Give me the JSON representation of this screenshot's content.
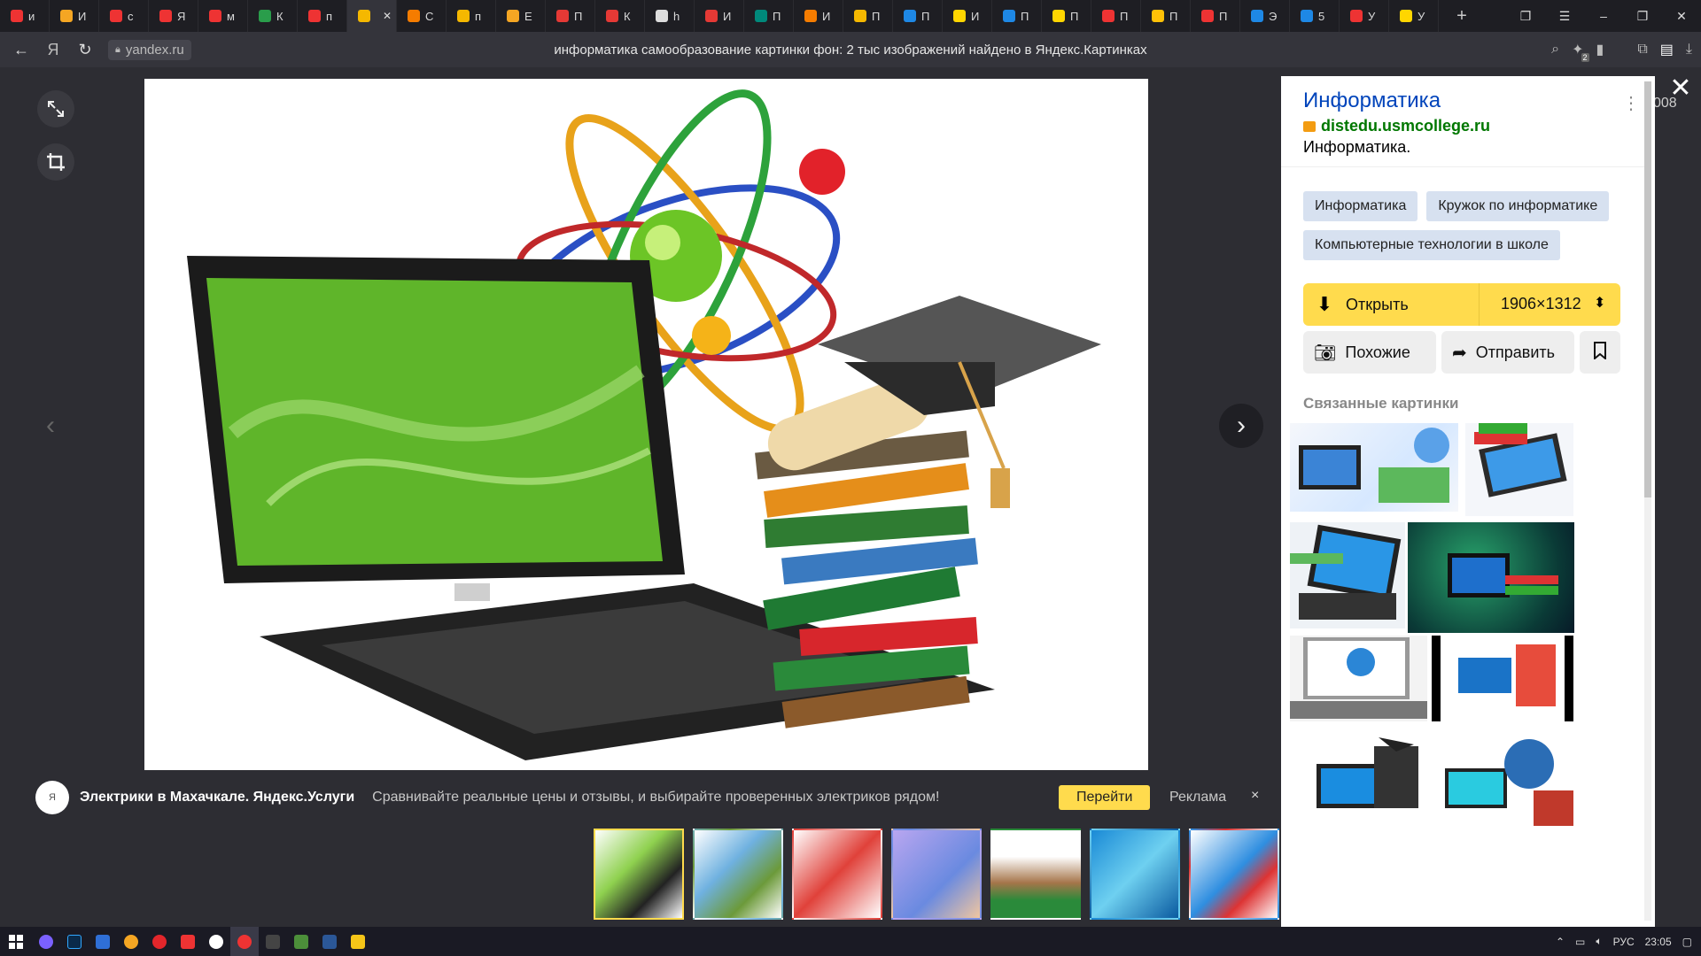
{
  "browser": {
    "tabs": [
      {
        "letter": "и",
        "icon": "yandex-icon",
        "color": "#e33"
      },
      {
        "letter": "И",
        "icon": "colorful-icon",
        "color": "#f5a623"
      },
      {
        "letter": "с",
        "icon": "yandex-icon",
        "color": "#e33"
      },
      {
        "letter": "Я",
        "icon": "yandex-icon",
        "color": "#e33"
      },
      {
        "letter": "м",
        "icon": "yandex-icon",
        "color": "#e33"
      },
      {
        "letter": "К",
        "icon": "green-doc-icon",
        "color": "#2a9d4b"
      },
      {
        "letter": "п",
        "icon": "yandex-icon",
        "color": "#e33"
      },
      {
        "letter": "",
        "icon": "images-icon",
        "color": "#f5b800"
      },
      {
        "letter": "С",
        "icon": "orange-m-icon",
        "color": "#f57c00"
      },
      {
        "letter": "п",
        "icon": "images-icon",
        "color": "#f5b800"
      },
      {
        "letter": "Е",
        "icon": "yellow-grid-icon",
        "color": "#f5a623"
      },
      {
        "letter": "П",
        "icon": "red-cup-icon",
        "color": "#e53935"
      },
      {
        "letter": "К",
        "icon": "youtube-icon",
        "color": "#e53935"
      },
      {
        "letter": "h",
        "icon": "page-icon",
        "color": "#ddd"
      },
      {
        "letter": "И",
        "icon": "youtube-icon",
        "color": "#e53935"
      },
      {
        "letter": "П",
        "icon": "teal-icon",
        "color": "#00897b"
      },
      {
        "letter": "И",
        "icon": "hat-icon",
        "color": "#f57c00"
      },
      {
        "letter": "П",
        "icon": "pencil-icon",
        "color": "#f5b800"
      },
      {
        "letter": "П",
        "icon": "blue-text-icon",
        "color": "#1e88e5"
      },
      {
        "letter": "И",
        "icon": "info-icon",
        "color": "#ffd600"
      },
      {
        "letter": "П",
        "icon": "book-icon",
        "color": "#1e88e5"
      },
      {
        "letter": "П",
        "icon": "info-icon",
        "color": "#ffd600"
      },
      {
        "letter": "П",
        "icon": "yandex-icon",
        "color": "#e33"
      },
      {
        "letter": "П",
        "icon": "play-icon",
        "color": "#ffc107"
      },
      {
        "letter": "П",
        "icon": "yandex-icon",
        "color": "#e33"
      },
      {
        "letter": "Э",
        "icon": "person-icon",
        "color": "#1e88e5"
      },
      {
        "letter": "5",
        "icon": "person-icon",
        "color": "#1e88e5"
      },
      {
        "letter": "У",
        "icon": "yandex-icon",
        "color": "#e33"
      },
      {
        "letter": "У",
        "icon": "info-icon",
        "color": "#ffd600"
      }
    ],
    "new_tab": "+",
    "url": "yandex.ru",
    "page_title": "информатика самообразование картинки фон: 2 тыс изображений найдено в Яндекс.Картинках",
    "downloads_badge": "2"
  },
  "viewer": {
    "ad": {
      "logo_text": "Я",
      "title": "Электрики в Махачкале. Яндекс.Услуги",
      "text": "Сравнивайте реальные цены и отзывы, и выбирайте проверенных электриков рядом!",
      "button": "Перейти",
      "label": "Реклама",
      "close": "×"
    },
    "next": "›",
    "prev": "‹",
    "close": "✕",
    "bg_number": "008",
    "thumbnails": [
      {
        "theme": "laptop-atom",
        "selected": true
      },
      {
        "theme": "globe-computer",
        "selected": false
      },
      {
        "theme": "red-laptop-books",
        "selected": false
      },
      {
        "theme": "purple-illustration",
        "selected": false
      },
      {
        "theme": "owl-books",
        "selected": false
      },
      {
        "theme": "blue-book",
        "selected": false
      },
      {
        "theme": "laptop-books-blue",
        "selected": false
      }
    ]
  },
  "sidebar": {
    "title": "Информатика",
    "domain": "distedu.usmcollege.ru",
    "description": "Информатика.",
    "tags": [
      "Информатика",
      "Кружок по информатике",
      "Компьютерные технологии в школе"
    ],
    "open_button": "Открыть",
    "size": "1906×1312",
    "similar_button": "Похожие",
    "share_button": "Отправить",
    "related_title": "Связанные картинки"
  },
  "taskbar": {
    "lang": "РУС",
    "time": "23:05"
  },
  "colors": {
    "accent": "#ffdb4d",
    "link": "#0044bb",
    "domain": "#007700",
    "tag_bg": "#d7e1f0"
  }
}
